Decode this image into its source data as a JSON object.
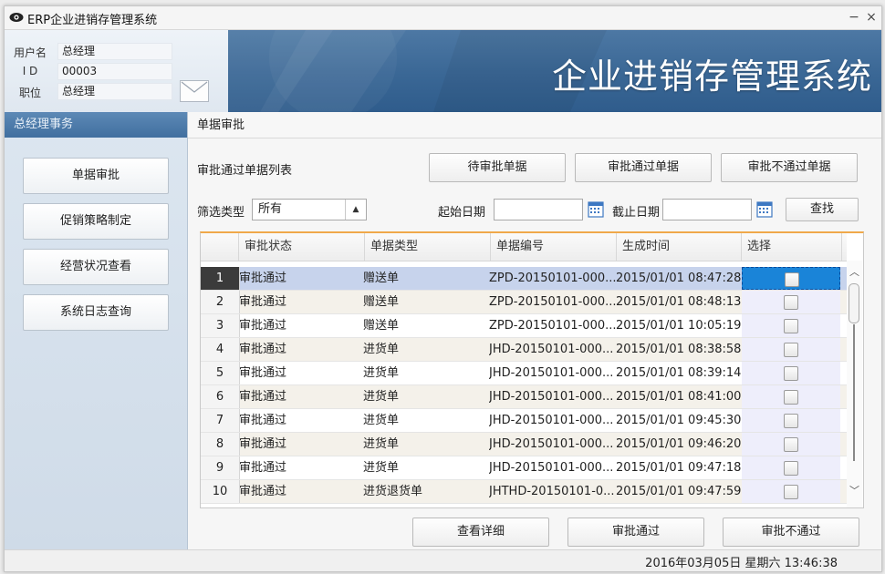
{
  "window": {
    "title": "ERP企业进销存管理系统",
    "minimize": "−",
    "close": "×"
  },
  "header": {
    "system_title": "企业进销存管理系统"
  },
  "user": {
    "fields": [
      {
        "label": "用户名",
        "value": "总经理"
      },
      {
        "label": "I D",
        "value": "00003"
      },
      {
        "label": "职位",
        "value": "总经理"
      }
    ]
  },
  "sidebar": {
    "title": "总经理事务",
    "items": [
      {
        "label": "单据审批"
      },
      {
        "label": "促销策略制定"
      },
      {
        "label": "经营状况查看"
      },
      {
        "label": "系统日志查询"
      }
    ]
  },
  "main": {
    "title": "单据审批",
    "list_title": "审批通过单据列表",
    "tabs": [
      {
        "label": "待审批单据"
      },
      {
        "label": "审批通过单据"
      },
      {
        "label": "审批不通过单据"
      }
    ],
    "filter": {
      "type_label": "筛选类型",
      "type_value": "所有",
      "start_label": "起始日期",
      "end_label": "截止日期",
      "search_label": "查找"
    },
    "table": {
      "columns": [
        "审批状态",
        "单据类型",
        "单据编号",
        "生成时间",
        "选择"
      ],
      "rows": [
        {
          "n": "1",
          "status": "审批通过",
          "type": "赠送单",
          "id": "ZPD-20150101-000...",
          "time": "2015/01/01 08:47:28"
        },
        {
          "n": "2",
          "status": "审批通过",
          "type": "赠送单",
          "id": "ZPD-20150101-000...",
          "time": "2015/01/01 08:48:13"
        },
        {
          "n": "3",
          "status": "审批通过",
          "type": "赠送单",
          "id": "ZPD-20150101-000...",
          "time": "2015/01/01 10:05:19"
        },
        {
          "n": "4",
          "status": "审批通过",
          "type": "进货单",
          "id": "JHD-20150101-000...",
          "time": "2015/01/01 08:38:58"
        },
        {
          "n": "5",
          "status": "审批通过",
          "type": "进货单",
          "id": "JHD-20150101-000...",
          "time": "2015/01/01 08:39:14"
        },
        {
          "n": "6",
          "status": "审批通过",
          "type": "进货单",
          "id": "JHD-20150101-000...",
          "time": "2015/01/01 08:41:00"
        },
        {
          "n": "7",
          "status": "审批通过",
          "type": "进货单",
          "id": "JHD-20150101-000...",
          "time": "2015/01/01 09:45:30"
        },
        {
          "n": "8",
          "status": "审批通过",
          "type": "进货单",
          "id": "JHD-20150101-000...",
          "time": "2015/01/01 09:46:20"
        },
        {
          "n": "9",
          "status": "审批通过",
          "type": "进货单",
          "id": "JHD-20150101-000...",
          "time": "2015/01/01 09:47:18"
        },
        {
          "n": "10",
          "status": "审批通过",
          "type": "进货退货单",
          "id": "JHTHD-20150101-0...",
          "time": "2015/01/01 09:47:59"
        }
      ]
    },
    "actions": [
      {
        "label": "查看详细"
      },
      {
        "label": "审批通过"
      },
      {
        "label": "审批不通过"
      }
    ]
  },
  "status": {
    "datetime": "2016年03月05日   星期六   13:46:38"
  },
  "colors": {
    "header_blue": "#3a6795",
    "accent_orange": "#f0a94a",
    "selection_blue": "#1a84d8"
  }
}
